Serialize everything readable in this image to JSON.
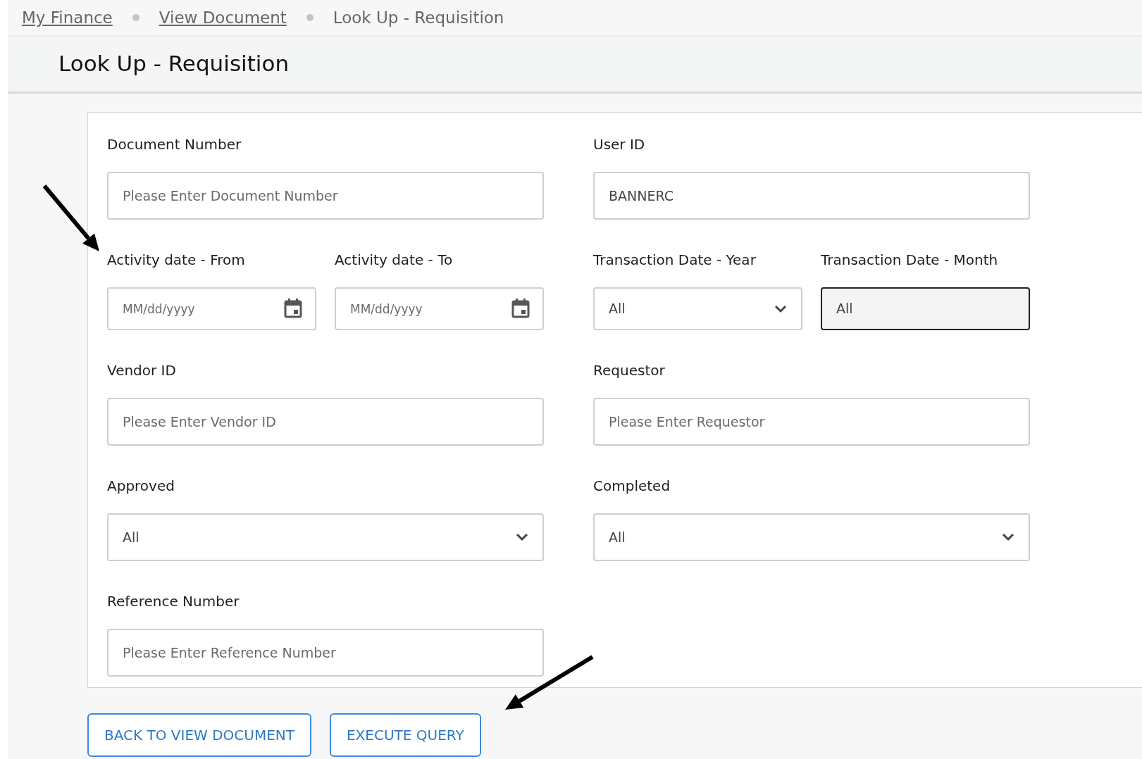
{
  "breadcrumb": [
    {
      "label": "My Finance",
      "link": true
    },
    {
      "label": "View Document",
      "link": true
    },
    {
      "label": "Look Up - Requisition",
      "link": false
    }
  ],
  "title": "Look Up - Requisition",
  "rows": [
    {
      "left": [
        {
          "kind": "text",
          "label": "Document Number",
          "placeholder": "Please Enter Document Number"
        }
      ],
      "right": [
        {
          "kind": "text",
          "label": "User ID",
          "value": "BANNERC"
        }
      ]
    },
    {
      "left": [
        {
          "kind": "date",
          "label": "Activity date - From",
          "placeholder": "MM/dd/yyyy"
        },
        {
          "kind": "date",
          "label": "Activity date - To",
          "placeholder": "MM/dd/yyyy"
        }
      ],
      "right": [
        {
          "kind": "select",
          "label": "Transaction Date - Year",
          "value": "All",
          "focused": false
        },
        {
          "kind": "select",
          "label": "Transaction Date - Month",
          "value": "All",
          "focused": true
        }
      ]
    },
    {
      "left": [
        {
          "kind": "text",
          "label": "Vendor ID",
          "placeholder": "Please Enter Vendor ID"
        }
      ],
      "right": [
        {
          "kind": "text",
          "label": "Requestor",
          "placeholder": "Please Enter Requestor"
        }
      ]
    },
    {
      "left": [
        {
          "kind": "select",
          "label": "Approved",
          "value": "All",
          "focused": false
        }
      ],
      "right": [
        {
          "kind": "select",
          "label": "Completed",
          "value": "All",
          "focused": false
        }
      ]
    },
    {
      "left": [
        {
          "kind": "text",
          "label": "Reference Number",
          "placeholder": "Please Enter Reference Number"
        }
      ],
      "right": []
    }
  ],
  "buttons": [
    "BACK TO VIEW DOCUMENT",
    "EXECUTE QUERY"
  ]
}
